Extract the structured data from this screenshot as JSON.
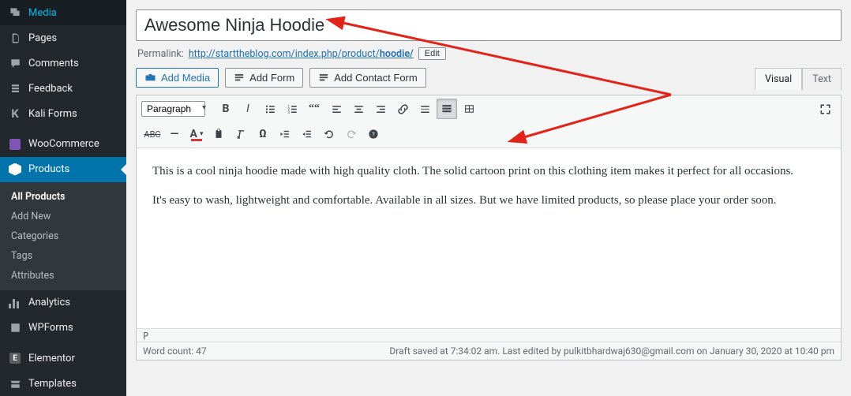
{
  "sidebar": {
    "items": [
      {
        "label": "Media",
        "icon": "media"
      },
      {
        "label": "Pages",
        "icon": "pages"
      },
      {
        "label": "Comments",
        "icon": "comment"
      },
      {
        "label": "Feedback",
        "icon": "feedback"
      },
      {
        "label": "Kali Forms",
        "icon": "kali"
      },
      {
        "label": "WooCommerce",
        "icon": "woo"
      },
      {
        "label": "Products",
        "icon": "box",
        "active": true
      },
      {
        "label": "Analytics",
        "icon": "bars"
      },
      {
        "label": "WPForms",
        "icon": "wpforms"
      },
      {
        "label": "Elementor",
        "icon": "elem"
      },
      {
        "label": "Templates",
        "icon": "templates"
      }
    ],
    "submenu": [
      {
        "label": "All Products",
        "current": true
      },
      {
        "label": "Add New"
      },
      {
        "label": "Categories"
      },
      {
        "label": "Tags"
      },
      {
        "label": "Attributes"
      }
    ]
  },
  "title": "Awesome Ninja Hoodie",
  "permalink": {
    "label": "Permalink:",
    "base": "http://starttheblog.com/index.php/product/",
    "slug": "hoodie/",
    "edit": "Edit"
  },
  "buttons": {
    "add_media": "Add Media",
    "add_form": "Add Form",
    "add_contact_form": "Add Contact Form"
  },
  "tabs": {
    "visual": "Visual",
    "text": "Text"
  },
  "toolbar": {
    "format": "Paragraph"
  },
  "content": {
    "p1": "This is a cool ninja hoodie made with high quality cloth. The solid cartoon print on this clothing item makes it perfect for all occasions.",
    "p2": "It's easy to wash, lightweight and comfortable. Available in all sizes. But we have limited products, so please place your order soon."
  },
  "status": {
    "path": "P",
    "wordcount": "Word count: 47",
    "draft": "Draft saved at 7:34:02 am. Last edited by pulkitbhardwaj630@gmail.com on January 30, 2020 at 10:40 pm"
  }
}
